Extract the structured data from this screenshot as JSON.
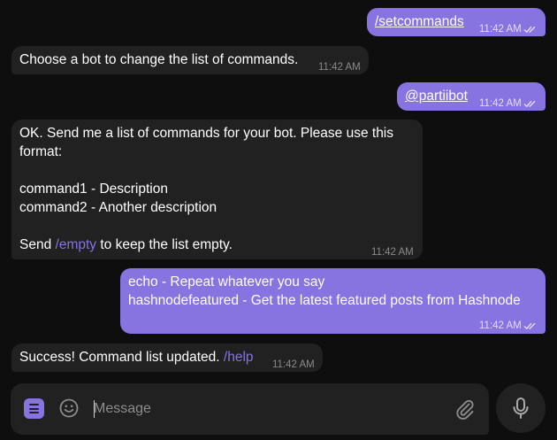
{
  "messages": [
    {
      "dir": "out",
      "text": "/setcommands",
      "time": "11:42 AM"
    },
    {
      "dir": "in",
      "text": "Choose a bot to change the list of commands.",
      "time": "11:42 AM"
    },
    {
      "dir": "out",
      "text": "@partiibot",
      "time": "11:42 AM"
    },
    {
      "dir": "in",
      "lines": [
        "OK. Send me a list of commands for your bot. Please use this",
        "format:",
        "",
        "command1 - Description",
        "command2 - Another description",
        ""
      ],
      "pre": "Send ",
      "link": "/empty",
      "post": " to keep the list empty.",
      "time": "11:42 AM"
    },
    {
      "dir": "out",
      "lines": [
        "echo - Repeat whatever you say",
        "hashnodefeatured - Get the latest featured posts from Hashnode"
      ],
      "time": "11:42 AM"
    },
    {
      "dir": "in",
      "pre": "Success! Command list updated. ",
      "link": "/help",
      "time": "11:42 AM"
    }
  ],
  "composer": {
    "placeholder": "Message",
    "menu_icon": "bot-menu-icon",
    "emoji_icon": "emoji-icon",
    "attach_icon": "paperclip-icon",
    "mic_icon": "microphone-icon"
  },
  "colors": {
    "background": "#0e0e0e",
    "incoming_bubble": "#212121",
    "outgoing_bubble": "#8774e1",
    "link": "#8774e1"
  }
}
